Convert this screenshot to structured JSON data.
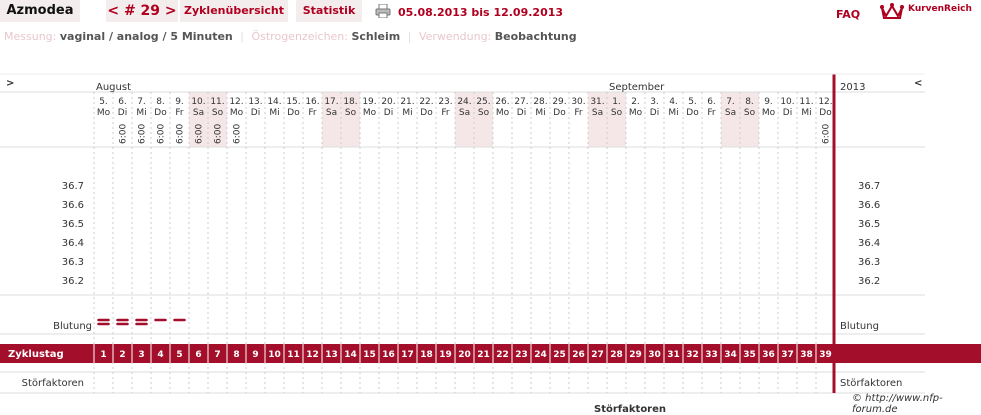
{
  "header": {
    "user_name": "Azmodea",
    "cycle_label": "< # 29 >",
    "overview_label": "Zyklenübersicht",
    "stats_label": "Statistik",
    "date_range": "05.08.2013 bis 12.09.2013",
    "faq_label": "FAQ",
    "logo_text": "KurvenReich",
    "printer_icon": "printer-icon",
    "logo_icon": "crown-icon"
  },
  "info": {
    "measure_label": "Messung:",
    "measure_value": "vaginal / analog / 5 Minuten",
    "estrogen_label": "Östrogenzeichen:",
    "estrogen_value": "Schleim",
    "usage_label": "Verwendung:",
    "usage_value": "Beobachtung"
  },
  "chart": {
    "left_arrow": ">",
    "right_arrow": "<",
    "year": "2013",
    "month_august": "August",
    "month_september": "September",
    "days": [
      {
        "d": "5.",
        "w": "Mo",
        "t": ""
      },
      {
        "d": "6.",
        "w": "Di",
        "t": "6:00"
      },
      {
        "d": "7.",
        "w": "Mi",
        "t": "6:00"
      },
      {
        "d": "8.",
        "w": "Do",
        "t": "6:00"
      },
      {
        "d": "9.",
        "w": "Fr",
        "t": "6:00"
      },
      {
        "d": "10.",
        "w": "Sa",
        "t": "6:00"
      },
      {
        "d": "11.",
        "w": "So",
        "t": "6:00"
      },
      {
        "d": "12.",
        "w": "Mo",
        "t": "6:00"
      },
      {
        "d": "13.",
        "w": "Di",
        "t": ""
      },
      {
        "d": "14.",
        "w": "Mi",
        "t": ""
      },
      {
        "d": "15.",
        "w": "Do",
        "t": ""
      },
      {
        "d": "16.",
        "w": "Fr",
        "t": ""
      },
      {
        "d": "17.",
        "w": "Sa",
        "t": ""
      },
      {
        "d": "18.",
        "w": "So",
        "t": ""
      },
      {
        "d": "19.",
        "w": "Mo",
        "t": ""
      },
      {
        "d": "20.",
        "w": "Di",
        "t": ""
      },
      {
        "d": "21.",
        "w": "Mi",
        "t": ""
      },
      {
        "d": "22.",
        "w": "Do",
        "t": ""
      },
      {
        "d": "23.",
        "w": "Fr",
        "t": ""
      },
      {
        "d": "24.",
        "w": "Sa",
        "t": ""
      },
      {
        "d": "25.",
        "w": "So",
        "t": ""
      },
      {
        "d": "26.",
        "w": "Mo",
        "t": ""
      },
      {
        "d": "27.",
        "w": "Di",
        "t": ""
      },
      {
        "d": "28.",
        "w": "Mi",
        "t": ""
      },
      {
        "d": "29.",
        "w": "Do",
        "t": ""
      },
      {
        "d": "30.",
        "w": "Fr",
        "t": ""
      },
      {
        "d": "31.",
        "w": "Sa",
        "t": ""
      },
      {
        "d": "1.",
        "w": "So",
        "t": ""
      },
      {
        "d": "2.",
        "w": "Mo",
        "t": ""
      },
      {
        "d": "3.",
        "w": "Di",
        "t": ""
      },
      {
        "d": "4.",
        "w": "Mi",
        "t": ""
      },
      {
        "d": "5.",
        "w": "Do",
        "t": ""
      },
      {
        "d": "6.",
        "w": "Fr",
        "t": ""
      },
      {
        "d": "7.",
        "w": "Sa",
        "t": ""
      },
      {
        "d": "8.",
        "w": "So",
        "t": ""
      },
      {
        "d": "9.",
        "w": "Mo",
        "t": ""
      },
      {
        "d": "10.",
        "w": "Di",
        "t": ""
      },
      {
        "d": "11.",
        "w": "Mi",
        "t": ""
      },
      {
        "d": "12.",
        "w": "Do",
        "t": "6:00"
      }
    ],
    "temp_labels": [
      "36.7",
      "36.6",
      "36.5",
      "36.4",
      "36.3",
      "36.2"
    ],
    "bleeding_label": "Blutung",
    "bleeding": [
      2,
      2,
      2,
      1,
      1,
      0,
      0,
      0,
      0,
      0,
      0,
      0,
      0,
      0,
      0,
      0,
      0,
      0,
      0,
      0,
      0,
      0,
      0,
      0,
      0,
      0,
      0,
      0,
      0,
      0,
      0,
      0,
      0,
      0,
      0,
      0,
      0,
      0,
      0
    ],
    "cycle_day_label": "Zyklustag",
    "cycle_days": [
      "1",
      "2",
      "3",
      "4",
      "5",
      "6",
      "7",
      "8",
      "9",
      "10",
      "11",
      "12",
      "13",
      "14",
      "15",
      "16",
      "17",
      "18",
      "19",
      "20",
      "21",
      "22",
      "23",
      "24",
      "25",
      "26",
      "27",
      "28",
      "29",
      "30",
      "31",
      "32",
      "33",
      "34",
      "35",
      "36",
      "37",
      "38",
      "39"
    ],
    "disruptor_label": "Störfaktoren",
    "colors": {
      "accent": "#a30f2a",
      "weekend": "#f5e6e8",
      "grid": "#cccccc"
    }
  },
  "footer": {
    "credit": "© http://www.nfp-forum.de",
    "disruptor_bottom": "Störfaktoren"
  }
}
